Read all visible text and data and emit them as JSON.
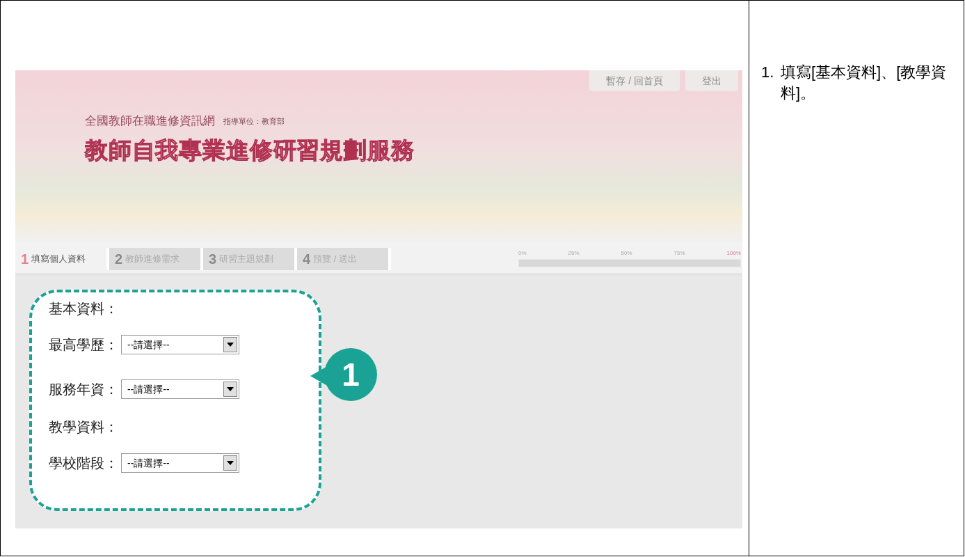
{
  "screenshot": {
    "header": {
      "site_name": "全國教師在職進修資訊網",
      "agency": "指導單位：教育部",
      "title": "教師自我專業進修研習規劃服務",
      "buttons": [
        {
          "label": "暫存 / 回首頁"
        },
        {
          "label": "登出"
        }
      ]
    },
    "steps": [
      {
        "number": "1",
        "label": "填寫個人資料",
        "selected": true
      },
      {
        "number": "2",
        "label": "教師進修需求",
        "selected": false
      },
      {
        "number": "3",
        "label": "研習主題規劃",
        "selected": false
      },
      {
        "number": "4",
        "label": "預覽 / 送出",
        "selected": false
      }
    ],
    "progress": {
      "ticks": [
        "0%",
        "25%",
        "50%",
        "75%",
        "100%"
      ]
    },
    "sections": [
      {
        "title": "基本資料：",
        "fields": [
          {
            "label": "最高學歷：",
            "value": "--請選擇--"
          },
          {
            "label": "服務年資：",
            "value": "--請選擇--"
          }
        ]
      },
      {
        "title": "教學資料：",
        "fields": [
          {
            "label": "學校階段：",
            "value": "--請選擇--"
          }
        ]
      }
    ],
    "callout": "1"
  },
  "instructions": [
    {
      "number": "1.",
      "text": "填寫[基本資料]、[教學資料]。"
    }
  ]
}
